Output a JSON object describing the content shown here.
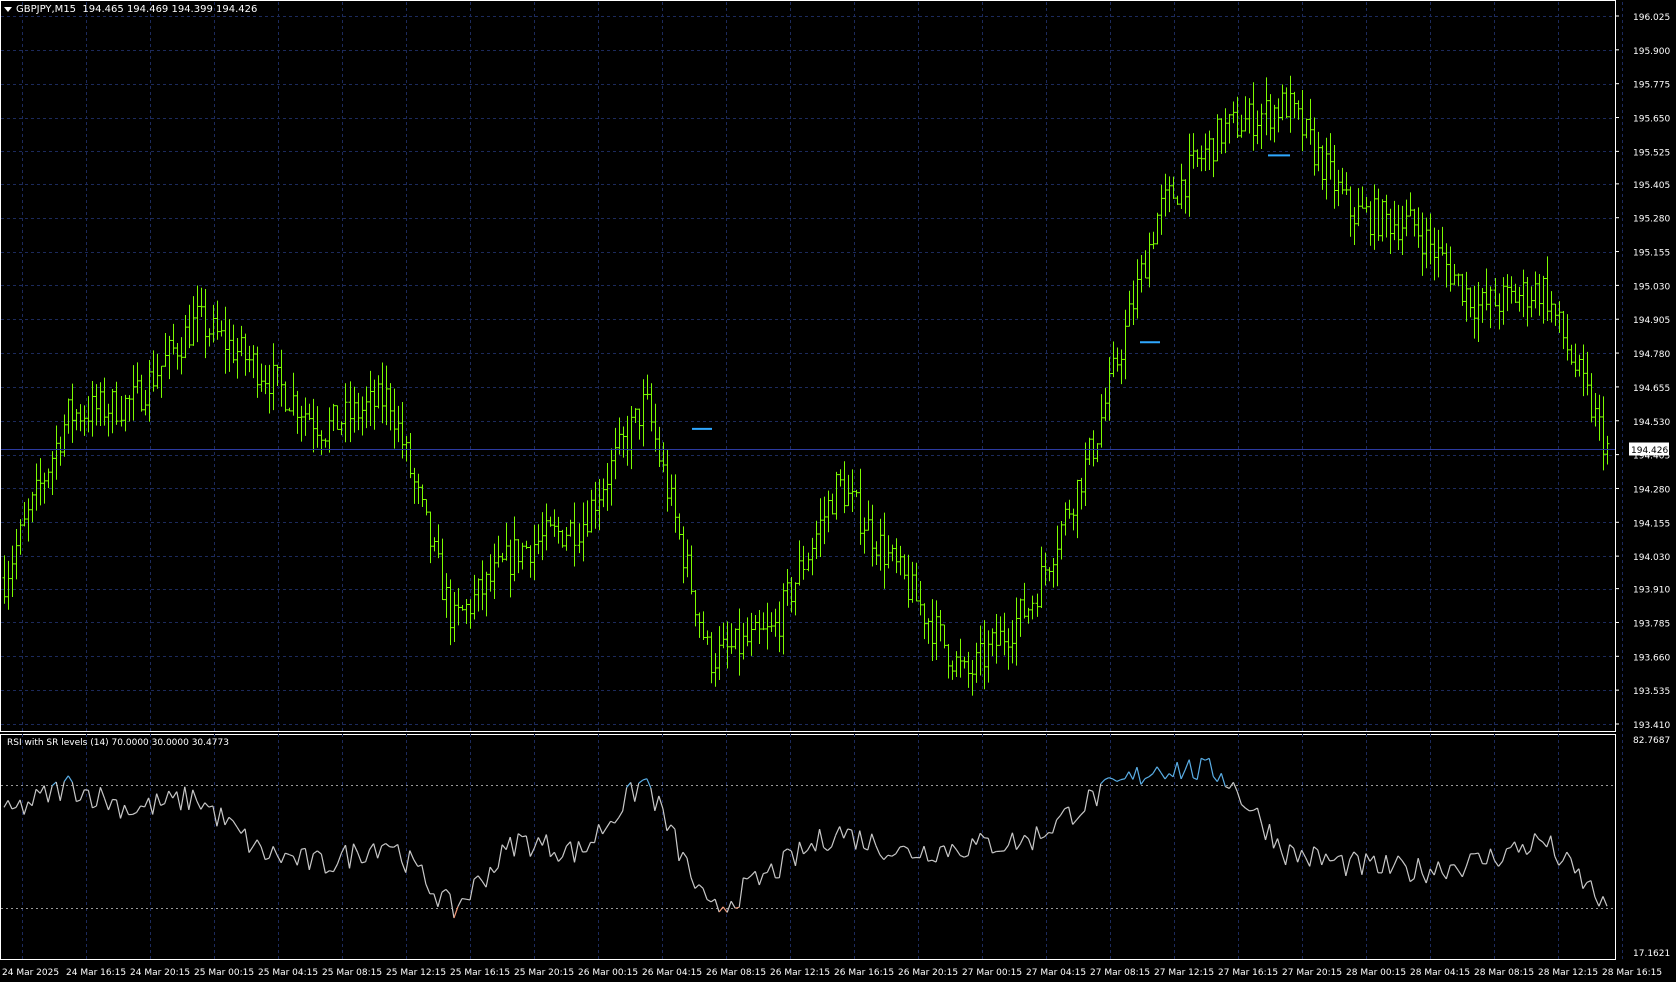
{
  "header": {
    "symbol": "GBPJPY,M15",
    "ohlc": "194.465 194.469 194.399 194.426"
  },
  "price_axis": {
    "labels": [
      "196.025",
      "195.900",
      "195.775",
      "195.650",
      "195.525",
      "195.405",
      "195.280",
      "195.155",
      "195.030",
      "194.905",
      "194.780",
      "194.655",
      "194.530",
      "194.405",
      "194.280",
      "194.155",
      "194.030",
      "193.910",
      "193.785",
      "193.660",
      "193.535",
      "193.410"
    ],
    "current_price": "194.426"
  },
  "indicator": {
    "title": "RSI with SR levels (14) 70.0000 30.0000 30.4773",
    "axis_max": "82.7687",
    "axis_min": "17.1621"
  },
  "time_axis": {
    "labels": [
      "24 Mar 2025",
      "24 Mar 16:15",
      "24 Mar 20:15",
      "25 Mar 00:15",
      "25 Mar 04:15",
      "25 Mar 08:15",
      "25 Mar 12:15",
      "25 Mar 16:15",
      "25 Mar 20:15",
      "26 Mar 00:15",
      "26 Mar 04:15",
      "26 Mar 08:15",
      "26 Mar 12:15",
      "26 Mar 16:15",
      "26 Mar 20:15",
      "27 Mar 00:15",
      "27 Mar 04:15",
      "27 Mar 08:15",
      "27 Mar 12:15",
      "27 Mar 16:15",
      "27 Mar 20:15",
      "28 Mar 00:15",
      "28 Mar 04:15",
      "28 Mar 08:15",
      "28 Mar 12:15",
      "28 Mar 16:15"
    ]
  },
  "colors": {
    "background": "#000000",
    "grid": "#1c2a5c",
    "bars": "#7cfc00",
    "rsi_line": "#c8c8c8",
    "rsi_overbought": "#5aaee6",
    "rsi_oversold": "#f29a7a",
    "sr_level": "#2fa8ff",
    "current_price_line": "#2b3aa0",
    "text": "#ffffff"
  },
  "chart_data": [
    {
      "type": "bar",
      "name": "GBPJPY,M15",
      "ylim": [
        193.41,
        196.025
      ],
      "x": [
        "24 Mar 2025",
        "24 Mar 16:15",
        "24 Mar 20:15",
        "25 Mar 00:15",
        "25 Mar 04:15",
        "25 Mar 08:15",
        "25 Mar 12:15",
        "25 Mar 16:15",
        "25 Mar 20:15",
        "26 Mar 00:15",
        "26 Mar 04:15",
        "26 Mar 08:15",
        "26 Mar 12:15",
        "26 Mar 16:15",
        "26 Mar 20:15",
        "27 Mar 00:15",
        "27 Mar 04:15",
        "27 Mar 08:15",
        "27 Mar 12:15",
        "27 Mar 16:15",
        "27 Mar 20:15",
        "28 Mar 00:15",
        "28 Mar 04:15",
        "28 Mar 08:15",
        "28 Mar 12:15",
        "28 Mar 16:15"
      ],
      "close": [
        193.95,
        194.55,
        194.6,
        194.9,
        194.72,
        194.5,
        194.62,
        193.78,
        194.05,
        194.15,
        194.6,
        193.65,
        193.75,
        194.3,
        193.95,
        193.58,
        193.85,
        194.45,
        195.3,
        195.6,
        195.7,
        195.3,
        195.25,
        194.95,
        195.02,
        194.43
      ],
      "support_resistance": [
        {
          "from": "26 Mar 04:15",
          "to": "26 Mar 08:15",
          "price": 194.5
        },
        {
          "from": "27 Mar 08:15",
          "to": "27 Mar 12:15",
          "price": 194.82
        },
        {
          "from": "27 Mar 16:15",
          "to": "27 Mar 16:15",
          "price": 195.51
        }
      ]
    },
    {
      "type": "line",
      "name": "RSI with SR levels (14)",
      "ylim": [
        17.1621,
        82.7687
      ],
      "levels": [
        70,
        30
      ],
      "x": [
        "24 Mar 2025",
        "24 Mar 16:15",
        "24 Mar 20:15",
        "25 Mar 00:15",
        "25 Mar 04:15",
        "25 Mar 08:15",
        "25 Mar 12:15",
        "25 Mar 16:15",
        "25 Mar 20:15",
        "26 Mar 00:15",
        "26 Mar 04:15",
        "26 Mar 08:15",
        "26 Mar 12:15",
        "26 Mar 16:15",
        "26 Mar 20:15",
        "27 Mar 00:15",
        "27 Mar 04:15",
        "27 Mar 08:15",
        "27 Mar 12:15",
        "27 Mar 16:15",
        "27 Mar 20:15",
        "28 Mar 00:15",
        "28 Mar 04:15",
        "28 Mar 08:15",
        "28 Mar 12:15",
        "28 Mar 16:15"
      ],
      "values": [
        60,
        70,
        62,
        66,
        48,
        44,
        52,
        29,
        52,
        48,
        72,
        28,
        42,
        55,
        48,
        50,
        52,
        66,
        76,
        74,
        48,
        44,
        42,
        45,
        52,
        30.4773
      ]
    }
  ]
}
